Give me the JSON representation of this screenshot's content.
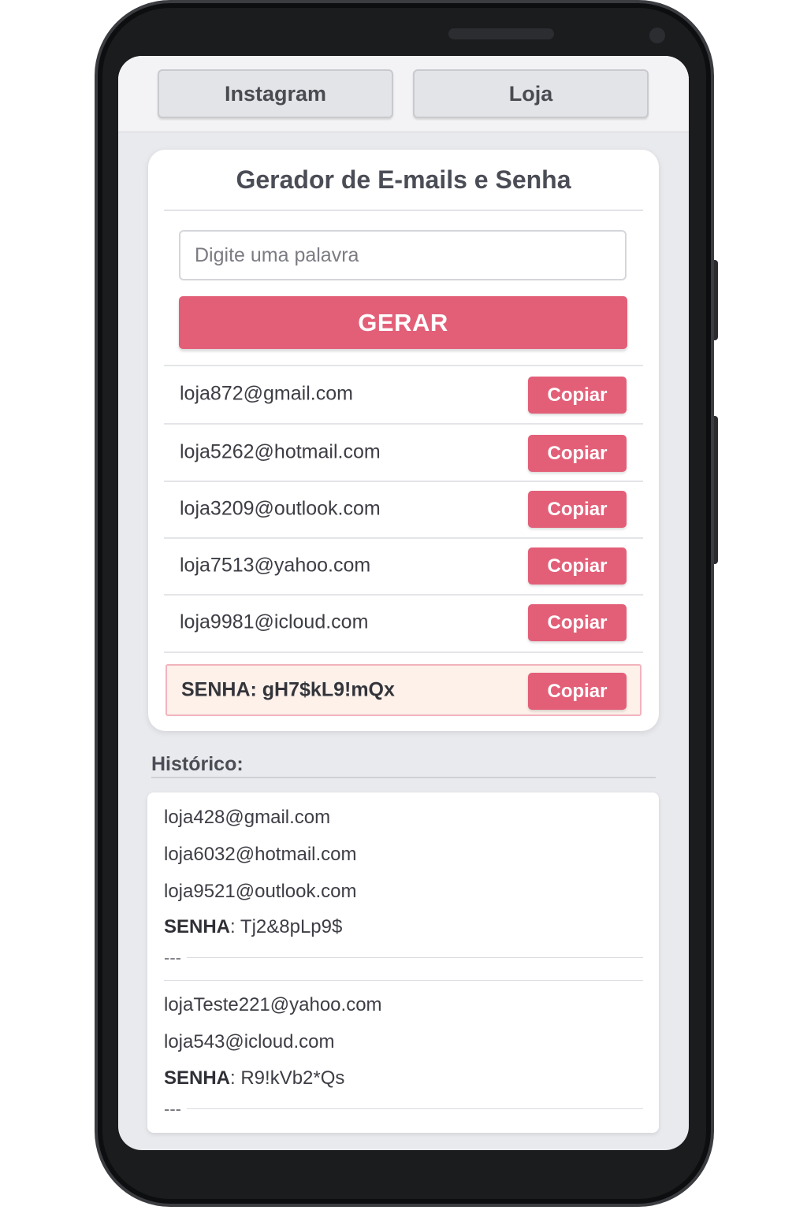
{
  "tabs": [
    {
      "label": "Instagram"
    },
    {
      "label": "Loja"
    }
  ],
  "generator": {
    "title": "Gerador de E-mails e Senha",
    "input_placeholder": "Digite uma palavra",
    "input_value": "",
    "generate_label": "GERAR",
    "emails": [
      {
        "address": "loja872@gmail.com",
        "copy_label": "Copiar"
      },
      {
        "address": "loja5262@hotmail.com",
        "copy_label": "Copiar"
      },
      {
        "address": "loja3209@outlook.com",
        "copy_label": "Copiar"
      },
      {
        "address": "loja7513@yahoo.com",
        "copy_label": "Copiar"
      },
      {
        "address": "loja9981@icloud.com",
        "copy_label": "Copiar"
      }
    ],
    "password": {
      "text": "SENHA: gH7$kL9!mQx",
      "copy_label": "Copiar"
    }
  },
  "history": {
    "title": "Histórico:",
    "entries": [
      {
        "emails": [
          "loja428@gmail.com",
          "loja6032@hotmail.com",
          "loja9521@outlook.com"
        ],
        "password_label": "SENHA",
        "password_value": ": Tj2&8pLp9$",
        "separator": "---"
      },
      {
        "emails": [
          "lojaTeste221@yahoo.com",
          "loja543@icloud.com"
        ],
        "password_label": "SENHA",
        "password_value": ": R9!kVb2*Qs",
        "separator": "---"
      }
    ]
  },
  "colors": {
    "accent": "#e35f78",
    "password_bg": "#fdf1ea",
    "screen_bg": "#e9eaee"
  }
}
